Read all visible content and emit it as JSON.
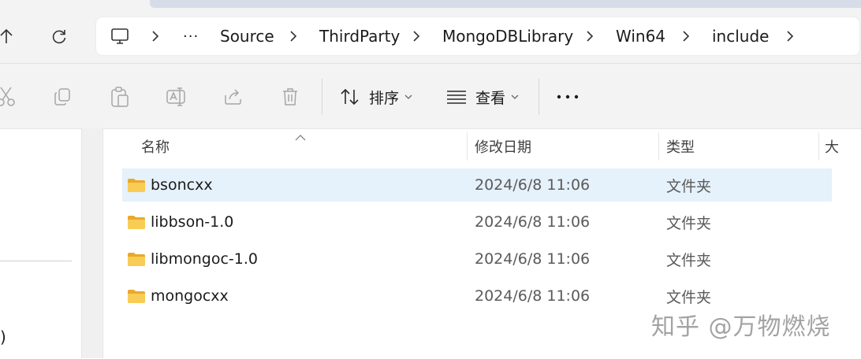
{
  "address_bar": {
    "overflow_label": "···",
    "crumbs": [
      "Source",
      "ThirdParty",
      "MongoDBLibrary",
      "Win64",
      "include"
    ]
  },
  "toolbar": {
    "sort_label": "排序",
    "view_label": "查看",
    "more_label": "···"
  },
  "columns": {
    "name": "名称",
    "modified": "修改日期",
    "type": "类型",
    "size_partial": "大"
  },
  "files": [
    {
      "name": "bsoncxx",
      "modified": "2024/6/8 11:06",
      "type": "文件夹",
      "selected": true
    },
    {
      "name": "libbson-1.0",
      "modified": "2024/6/8 11:06",
      "type": "文件夹",
      "selected": false
    },
    {
      "name": "libmongoc-1.0",
      "modified": "2024/6/8 11:06",
      "type": "文件夹",
      "selected": false
    },
    {
      "name": "mongocxx",
      "modified": "2024/6/8 11:06",
      "type": "文件夹",
      "selected": false
    }
  ],
  "sidebar": {
    "partial_text": ")"
  },
  "watermark": "知乎 @万物燃烧",
  "icons": {
    "nav": [
      "up-arrow-icon",
      "refresh-icon"
    ],
    "toolbar": [
      "cut-icon",
      "copy-icon",
      "paste-icon",
      "rename-icon",
      "share-icon",
      "delete-icon",
      "sort-icon",
      "view-icon",
      "more-icon"
    ]
  },
  "colors": {
    "selection": "#e5f1fb",
    "folder": "#f6c244"
  }
}
